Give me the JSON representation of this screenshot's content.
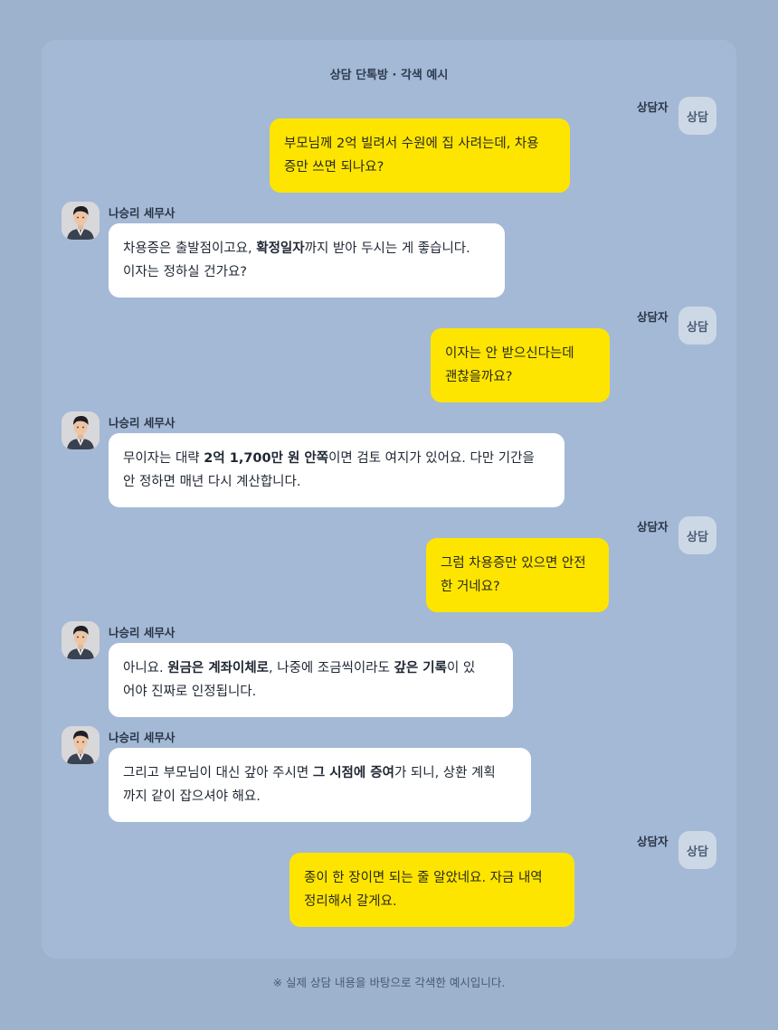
{
  "header": {
    "title": "상담 단톡방 · 각색 예시"
  },
  "footer": {
    "note": "※ 실제 상담 내용을 바탕으로 각색한 예시입니다."
  },
  "colors": {
    "background": "#9db2cd",
    "panel": "#a4b9d5",
    "my_bubble": "#fee500",
    "their_bubble": "#ffffff",
    "badge": "#cdd8e6"
  },
  "client": {
    "name": "상담자",
    "badge": "상담"
  },
  "advisor": {
    "name": "나승리 세무사",
    "avatar_icon": "person-avatar-icon"
  },
  "messages": [
    {
      "from": "client",
      "lines": [
        [
          {
            "t": "부모님께 2억 빌려서 수원에 집 사려는데, 차용"
          }
        ],
        [
          {
            "t": "증만 쓰면 되나요?"
          }
        ]
      ]
    },
    {
      "from": "advisor",
      "lines": [
        [
          {
            "t": "차용증은 출발점이고요, "
          },
          {
            "t": "확정일자",
            "b": true
          },
          {
            "t": "까지 받아 두시는 게 좋습니다."
          }
        ],
        [
          {
            "t": "이자는 정하실 건가요?"
          }
        ]
      ]
    },
    {
      "from": "client",
      "lines": [
        [
          {
            "t": "이자는 안 받으신다는데"
          }
        ],
        [
          {
            "t": "괜찮을까요?"
          }
        ]
      ]
    },
    {
      "from": "advisor",
      "lines": [
        [
          {
            "t": "무이자는 대략 "
          },
          {
            "t": "2억 1,700만 원 안쪽",
            "b": true
          },
          {
            "t": "이면 검토 여지가 있어요. 다만 기간을"
          }
        ],
        [
          {
            "t": "안 정하면 매년 다시 계산합니다."
          }
        ]
      ]
    },
    {
      "from": "client",
      "lines": [
        [
          {
            "t": "그럼 차용증만 있으면 안전"
          }
        ],
        [
          {
            "t": "한 거네요?"
          }
        ]
      ]
    },
    {
      "from": "advisor",
      "lines": [
        [
          {
            "t": "아니요. "
          },
          {
            "t": "원금은 계좌이체로",
            "b": true
          },
          {
            "t": ", 나중에 조금씩이라도 "
          },
          {
            "t": "갚은 기록",
            "b": true
          },
          {
            "t": "이 있"
          }
        ],
        [
          {
            "t": "어야 진짜로 인정됩니다."
          }
        ]
      ]
    },
    {
      "from": "advisor",
      "lines": [
        [
          {
            "t": "그리고 부모님이 대신 갚아 주시면 "
          },
          {
            "t": "그 시점에 증여",
            "b": true
          },
          {
            "t": "가 되니, 상환 계획"
          }
        ],
        [
          {
            "t": "까지 같이 잡으셔야 해요."
          }
        ]
      ]
    },
    {
      "from": "client",
      "lines": [
        [
          {
            "t": "종이 한 장이면 되는 줄 알았네요. 자금 내역"
          }
        ],
        [
          {
            "t": "정리해서 갈게요."
          }
        ]
      ]
    }
  ]
}
